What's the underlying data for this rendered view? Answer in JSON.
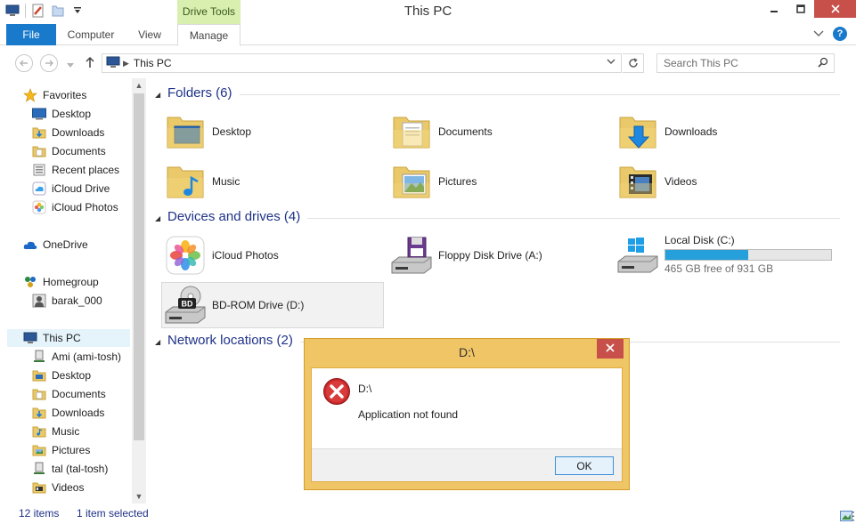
{
  "window": {
    "title": "This PC"
  },
  "qat": {
    "icons": [
      "this-pc-icon",
      "properties-icon",
      "new-folder-icon",
      "customize-dropdown-icon"
    ]
  },
  "ribbon": {
    "context_tab": "Drive Tools",
    "tabs": [
      {
        "label": "File"
      },
      {
        "label": "Computer"
      },
      {
        "label": "View"
      },
      {
        "label": "Manage"
      }
    ]
  },
  "address": {
    "path": "This PC"
  },
  "search": {
    "placeholder": "Search This PC",
    "value": ""
  },
  "nav": {
    "favorites": {
      "label": "Favorites",
      "items": [
        {
          "label": "Desktop"
        },
        {
          "label": "Downloads"
        },
        {
          "label": "Documents"
        },
        {
          "label": "Recent places"
        },
        {
          "label": "iCloud Drive"
        },
        {
          "label": "iCloud Photos"
        }
      ]
    },
    "onedrive": {
      "label": "OneDrive"
    },
    "homegroup": {
      "label": "Homegroup",
      "items": [
        {
          "label": "barak_000"
        }
      ]
    },
    "thispc": {
      "label": "This PC",
      "items": [
        {
          "label": "Ami (ami-tosh)"
        },
        {
          "label": "Desktop"
        },
        {
          "label": "Documents"
        },
        {
          "label": "Downloads"
        },
        {
          "label": "Music"
        },
        {
          "label": "Pictures"
        },
        {
          "label": "tal (tal-tosh)"
        },
        {
          "label": "Videos"
        }
      ]
    }
  },
  "content": {
    "folders": {
      "title": "Folders (6)",
      "items": [
        {
          "label": "Desktop"
        },
        {
          "label": "Documents"
        },
        {
          "label": "Downloads"
        },
        {
          "label": "Music"
        },
        {
          "label": "Pictures"
        },
        {
          "label": "Videos"
        }
      ]
    },
    "devices": {
      "title": "Devices and drives (4)",
      "items": [
        {
          "label": "iCloud Photos"
        },
        {
          "label": "Floppy Disk Drive (A:)"
        },
        {
          "label": "Local Disk (C:)",
          "free": "465 GB free of 931 GB",
          "used_fraction": 0.5
        },
        {
          "label": "BD-ROM Drive (D:)"
        }
      ]
    },
    "network": {
      "title": "Network locations (2)"
    }
  },
  "status": {
    "count": "12 items",
    "selected": "1 item selected"
  },
  "dialog": {
    "title": "D:\\",
    "line1": "D:\\",
    "message": "Application not found",
    "ok": "OK"
  },
  "colors": {
    "accent": "#1979ca",
    "drive_tools": "#d8efb0",
    "dialog_frame": "#f0c565",
    "close_red": "#c7504b",
    "disk_fill": "#26a0da"
  }
}
